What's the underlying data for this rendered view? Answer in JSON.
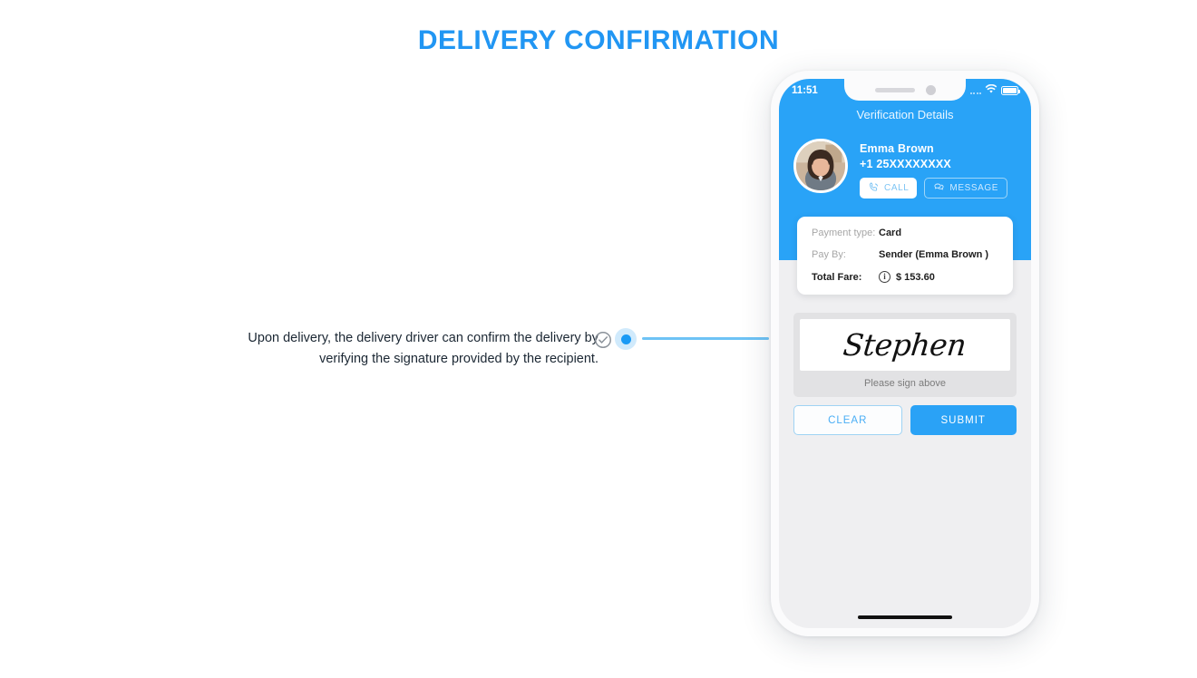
{
  "page": {
    "title": "DELIVERY CONFIRMATION",
    "accent_color": "#2196f3",
    "annotation": {
      "line1": "Upon delivery, the delivery driver can confirm the delivery by",
      "line2": "verifying the signature provided by the recipient.",
      "check_icon": "check-circle-icon",
      "marker": "blue-dot-marker",
      "connector": "connector-line"
    }
  },
  "phone": {
    "status_bar": {
      "time": "11:51",
      "signal_icon": "signal-dots-icon",
      "wifi_icon": "wifi-icon",
      "battery_icon": "battery-icon"
    },
    "screen_title": "Verification Details",
    "contact": {
      "avatar": "user-avatar-photo",
      "name": "Emma Brown",
      "phone": "+1 25XXXXXXXX",
      "call_label": "CALL",
      "call_icon": "phone-icon",
      "message_label": "MESSAGE",
      "message_icon": "chat-bubble-icon"
    },
    "payment": {
      "rows": [
        {
          "label": "Payment type:",
          "value": "Card",
          "bold_label": false,
          "has_info_icon": false
        },
        {
          "label": "Pay By:",
          "value": "Sender (Emma Brown )",
          "bold_label": false,
          "has_info_icon": false
        },
        {
          "label": "Total Fare:",
          "value": "$ 153.60",
          "bold_label": true,
          "has_info_icon": true
        }
      ],
      "info_icon": "info-icon",
      "info_glyph": "i"
    },
    "signature": {
      "value": "Stephen",
      "hint": "Please sign above"
    },
    "buttons": {
      "clear_label": "CLEAR",
      "submit_label": "SUBMIT",
      "submit_color": "#2aa2f6"
    },
    "home_indicator": "home-indicator"
  }
}
